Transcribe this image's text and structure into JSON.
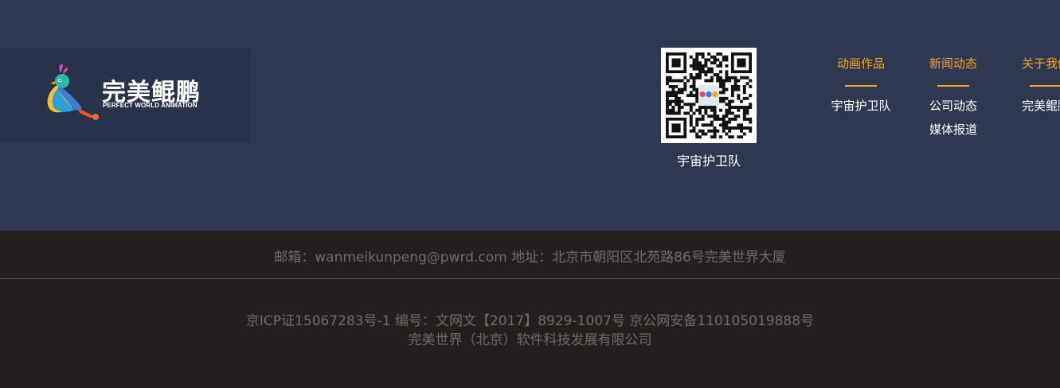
{
  "logo": {
    "cn": "完美鲲鹏",
    "en": "PERFECT WORLD ANIMATION"
  },
  "qr": {
    "caption": "宇宙护卫队"
  },
  "nav": [
    {
      "title": "动画作品",
      "links": [
        "宇宙护卫队"
      ]
    },
    {
      "title": "新闻动态",
      "links": [
        "公司动态",
        "媒体报道"
      ]
    },
    {
      "title": "关于我们",
      "links": [
        "完美鲲鹏"
      ]
    }
  ],
  "footer": {
    "contact": "邮箱：wanmeikunpeng@pwrd.com 地址：北京市朝阳区北苑路86号完美世界大厦",
    "icp": "京ICP证15067283号-1 编号：文网文【2017】8929-1007号 京公网安备110105019888号",
    "company": "完美世界（北京）软件科技发展有限公司"
  },
  "colors": {
    "top_bg": "#2e3851",
    "logo_bg": "#28324a",
    "bottom_bg": "#221f1e",
    "accent": "#f5a623",
    "footer_text": "#6f6a66"
  }
}
